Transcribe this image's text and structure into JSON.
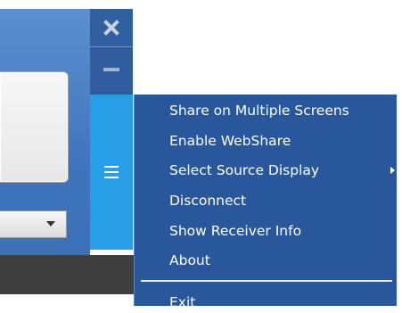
{
  "window": {
    "close_icon": "close-icon",
    "minimize_icon": "minimize-icon",
    "menu_icon": "hamburger-icon",
    "select_icon": "chevron-down-icon"
  },
  "menu": {
    "items": [
      "Share on Multiple Screens",
      "Enable WebShare",
      "Select Source Display",
      "Disconnect",
      "Show Receiver Info",
      "About"
    ],
    "exit": "Exit"
  },
  "colors": {
    "menu_bg": "#28579b",
    "menu_button": "#279ee5",
    "title_strip": "#30609f",
    "bottom_bar": "#3f3f3f"
  }
}
